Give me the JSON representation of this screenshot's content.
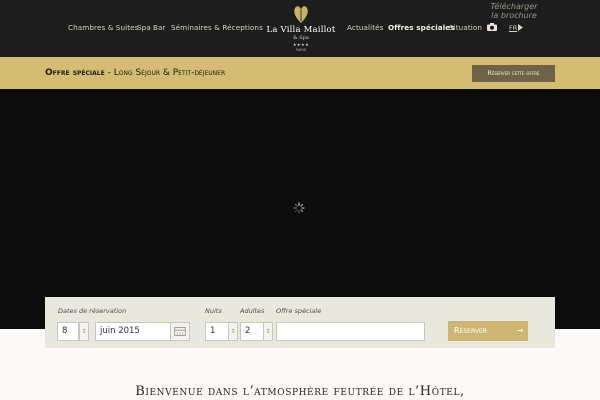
{
  "nav": {
    "chambres": "Chambres & Suites",
    "spa": "Spa",
    "bar": "Bar",
    "seminaires": "Séminaires & Réceptions",
    "actualites": "Actualités",
    "offres": "Offres spéciales",
    "situation": "Situation",
    "lang": "FR"
  },
  "logo": {
    "name": "La Villa Maillot",
    "spa": "& Spa",
    "stars": "★★★★",
    "city": "PARIS"
  },
  "brochure": "Télécharger la brochure",
  "offer_bar": {
    "label": "Offre spéciale",
    "separator": "-",
    "offer": "Long Séjour & Petit-déjeuner",
    "button": "Réserver cette offre"
  },
  "booking": {
    "dates_label": "Dates de réservation",
    "day": "8",
    "month": "juin 2015",
    "nights_label": "Nuits",
    "nights": "1",
    "adults_label": "Adultes",
    "adults": "2",
    "offer_label": "Offre spéciale",
    "offer_value": "",
    "reserve_button": "Réserver",
    "arrow": "→"
  },
  "welcome": {
    "text": "Bienvenue dans l’atmosphère feutrée de l’Hôtel,"
  },
  "colors": {
    "header_bg": "#1d1d1d",
    "accent_gold": "#d4bc73",
    "button_brown": "#706247",
    "panel_bg": "#e9e8df"
  },
  "icons": {
    "logo_mark": "heart-leaf-icon",
    "camera": "camera-icon",
    "lang_arrow": "triangle-right-icon",
    "spinner": "loading-spinner-icon",
    "step": "stepper-arrows-icon",
    "calendar": "calendar-icon"
  }
}
